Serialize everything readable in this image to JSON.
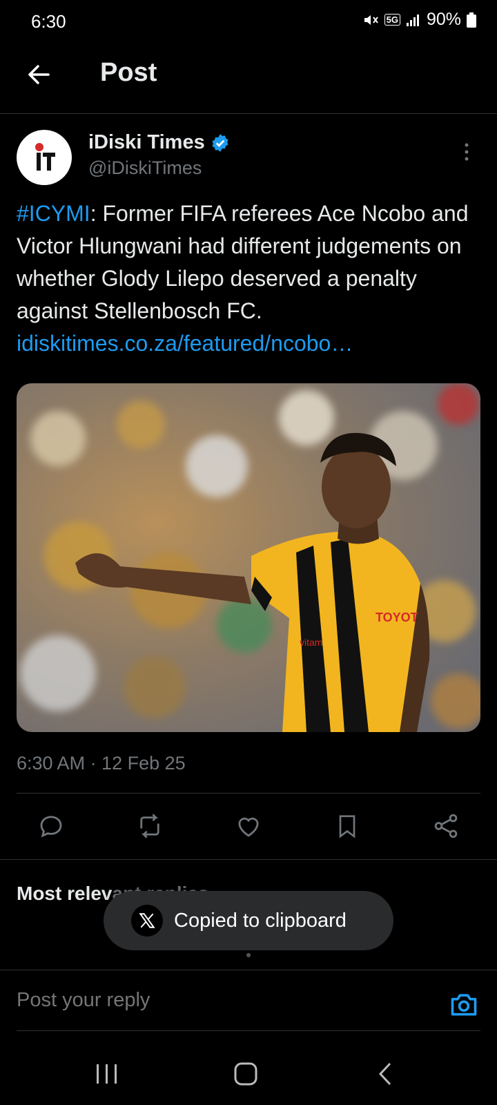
{
  "status": {
    "time": "6:30",
    "network": "5G",
    "battery": "90%"
  },
  "header": {
    "title": "Post"
  },
  "author": {
    "name": "iDiski Times",
    "handle": "@iDiskiTimes",
    "avatar_text": "IT"
  },
  "tweet": {
    "hashtag": "#ICYMI",
    "body": ": Former FIFA referees Ace Ncobo and Victor Hlungwani had different judgements on whether Glody Lilepo deserved a penalty against Stellenbosch FC. ",
    "link": "idiskitimes.co.za/featured/ncobo…",
    "timestamp": "6:30 AM · 12 Feb 25"
  },
  "media": {
    "jersey_text_1": "TOYOT",
    "jersey_text_2": "vitam"
  },
  "replies": {
    "label_visible": "Most relev",
    "label_faded": "ant replies"
  },
  "toast": {
    "text": "Copied to clipboard"
  },
  "reply": {
    "placeholder": "Post your reply"
  },
  "colors": {
    "accent": "#1d9bf0",
    "background": "#000000",
    "muted": "#71767b"
  }
}
